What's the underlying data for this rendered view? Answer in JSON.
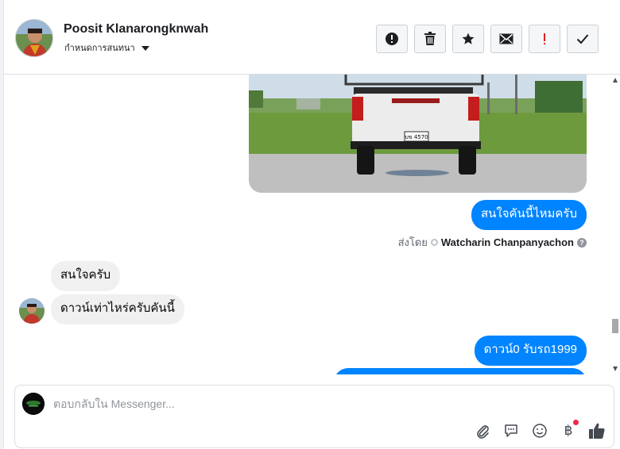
{
  "contact": {
    "name": "Poosit Klanarongknwah",
    "assign_label": "กำหนดการสนทนา"
  },
  "header_actions": [
    {
      "icon": "alert-circle-icon",
      "name": "mark-spam-button"
    },
    {
      "icon": "trash-icon",
      "name": "delete-button"
    },
    {
      "icon": "star-icon",
      "name": "star-button"
    },
    {
      "icon": "envelope-icon",
      "name": "mark-unread-button"
    },
    {
      "icon": "exclamation-icon",
      "name": "mark-important-button"
    },
    {
      "icon": "checkmark-icon",
      "name": "mark-done-button"
    }
  ],
  "messages": {
    "outgoing_1": "สนใจคันนี้ไหมครับ",
    "sent_by_prefix": "ส่งโดย",
    "sent_by_name": "Watcharin Chanpanyachon",
    "sent_by_help": "?",
    "incoming_1": "สนใจครับ",
    "incoming_2": "ดาวน์เท่าไหร่ครับคันนี้",
    "outgoing_2": "ดาวน์0 รับรถ1999"
  },
  "photo": {
    "plate_text": "บข 4570"
  },
  "composer": {
    "placeholder": "ตอบกลับใน Messenger...",
    "baht_symbol": "฿"
  },
  "colors": {
    "outgoing_bubble": "#0084ff",
    "incoming_bubble": "#f0f0f0",
    "notification_dot": "#f02849",
    "important_red": "#e02020"
  }
}
